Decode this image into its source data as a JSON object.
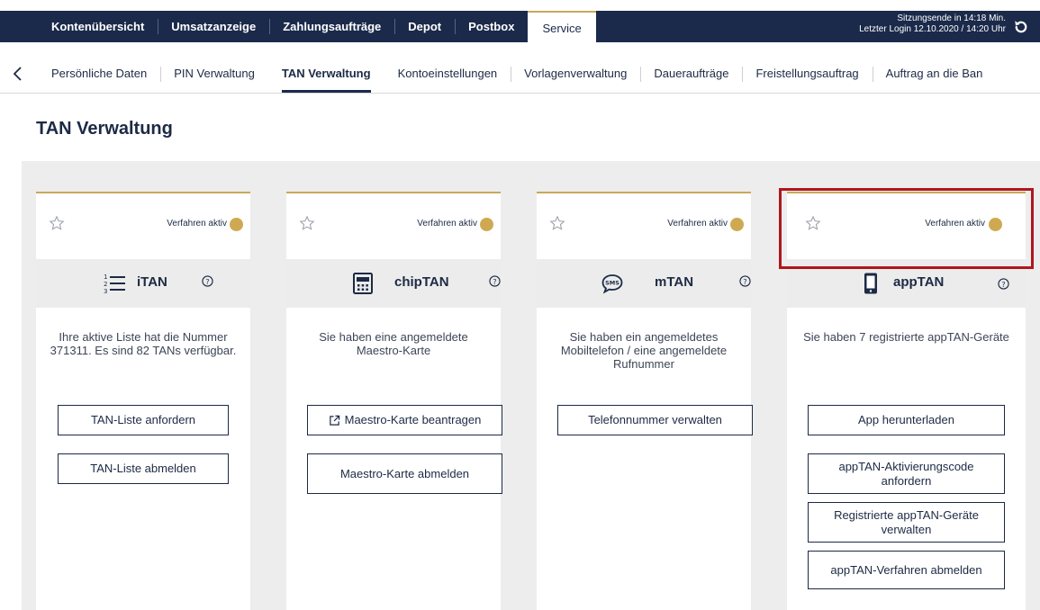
{
  "topnav": {
    "tabs": [
      "Kontenübersicht",
      "Umsatzanzeige",
      "Zahlungsaufträge",
      "Depot",
      "Postbox",
      "Service"
    ],
    "active_tab": "Service",
    "session_line1": "Sitzungsende in 14:18 Min.",
    "session_line2": "Letzter Login 12.10.2020 / 14:20 Uhr"
  },
  "subnav": {
    "tabs": [
      "Persönliche Daten",
      "PIN Verwaltung",
      "TAN Verwaltung",
      "Kontoeinstellungen",
      "Vorlagenverwaltung",
      "Daueraufträge",
      "Freistellungsauftrag",
      "Auftrag an die Ban"
    ],
    "active_tab": "TAN Verwaltung"
  },
  "page": {
    "title": "TAN Verwaltung"
  },
  "cards": [
    {
      "status": "Verfahren aktiv",
      "name": "iTAN",
      "icon": "list-numbered-icon",
      "description": "Ihre aktive Liste hat die Nummer 371311. Es sind 82 TANs verfügbar.",
      "buttons": [
        "TAN-Liste anfordern",
        "TAN-Liste abmelden"
      ]
    },
    {
      "status": "Verfahren aktiv",
      "name": "chipTAN",
      "icon": "calculator-icon",
      "description": "Sie haben eine angemeldete Maestro-Karte",
      "buttons": [
        "Maestro-Karte beantragen",
        "Maestro-Karte abmelden"
      ]
    },
    {
      "status": "Verfahren aktiv",
      "name": "mTAN",
      "icon": "sms-bubble-icon",
      "description": "Sie haben ein angemeldetes Mobiltelefon / eine angemeldete Rufnummer",
      "buttons": [
        "Telefonnummer verwalten"
      ]
    },
    {
      "status": "Verfahren aktiv",
      "name": "appTAN",
      "icon": "smartphone-icon",
      "description": "Sie haben 7 registrierte appTAN-Geräte",
      "buttons": [
        "App herunterladen",
        "appTAN-Aktivierungscode anfordern",
        "Registrierte appTAN-Geräte verwalten",
        "appTAN-Verfahren abmelden"
      ]
    }
  ],
  "colors": {
    "navy": "#1b2a4a",
    "gold": "#cfa952",
    "highlight": "#b0161e",
    "panel_bg": "#ededed"
  }
}
